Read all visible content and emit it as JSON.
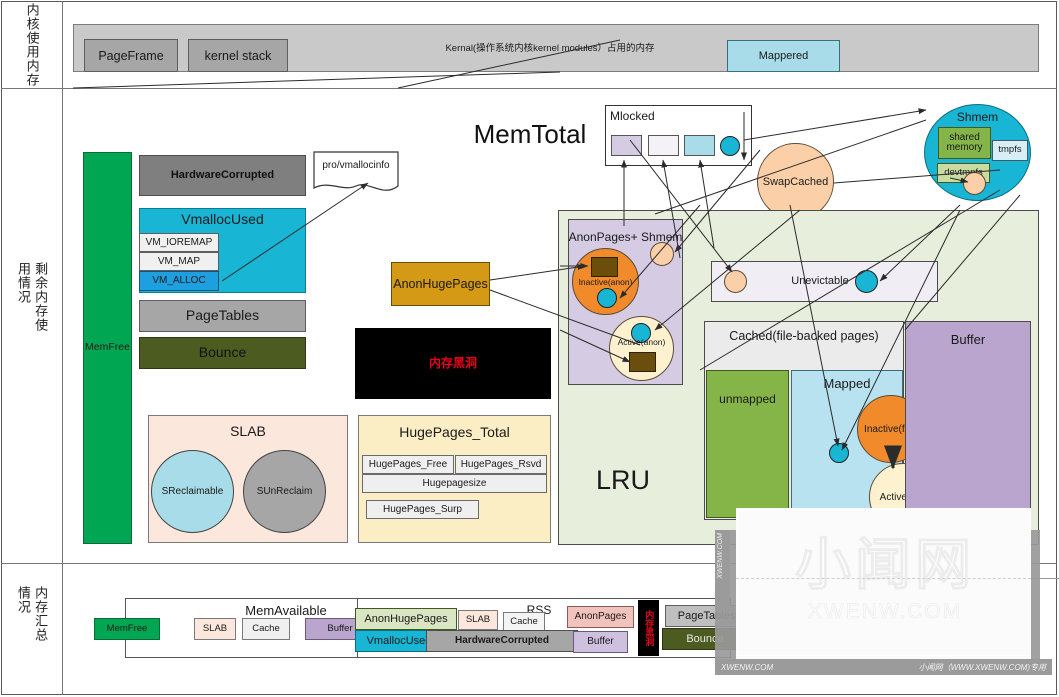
{
  "rows": {
    "kernel": "内核使用内存",
    "remaining": "剩余内存使用情况",
    "summary": "内存汇总情况"
  },
  "kernel_band": {
    "pageframe": "PageFrame",
    "kernel_stack": "kernel stack",
    "kernel_note": "Kernal(操作系统内核kernel modules）占用的内存",
    "mappered": "Mappered"
  },
  "middle": {
    "memtotal": "MemTotal",
    "memfree": "MemFree",
    "hardware_corrupted": "HardwareCorrupted",
    "vmalloc_used": "VmallocUsed",
    "vm_ioremap": "VM_IOREMAP",
    "vm_map": "VM_MAP",
    "vm_alloc": "VM_ALLOC",
    "pagetables": "PageTables",
    "bounce": "Bounce",
    "proc_vmallocinfo": "pro/vmallocinfo",
    "anonhugepages": "AnonHugePages",
    "blackhole": "内存黑洞",
    "slab": "SLAB",
    "sreclaimable": "SReclaimable",
    "sunreclaim": "SUnReclaim",
    "hugepages_total": "HugePages_Total",
    "hugepages_free": "HugePages_Free",
    "hugepages_rsvd": "HugePages_Rsvd",
    "hugepagesize": "Hugepagesize",
    "hugepages_surp": "HugePages_Surp",
    "mlocked": "Mlocked",
    "swapcached": "SwapCached",
    "shmem": "Shmem",
    "shared_memory": "shared memory",
    "tmpfs": "tmpfs",
    "devtmpfs": "devtmpfs",
    "lru": "LRU",
    "anonpages_shmem": "AnonPages+ Shmem",
    "inactive_anon": "Inactive(anon)",
    "active_anon": "Active(anon)",
    "unevictable": "Unevictable",
    "cached": "Cached(file-backed pages)",
    "unmapped": "unmapped",
    "mapped": "Mapped",
    "inactive_file": "Inactive(file)",
    "active_file": "Active(file)",
    "buffer": "Buffer"
  },
  "summary": {
    "memavailable": "MemAvailable",
    "memfree": "MemFree",
    "slab": "SLAB",
    "cache": "Cache",
    "buffer": "Buffer",
    "rss": "RSS",
    "anonhugepages": "AnonHugePages",
    "vmallocused": "VmallocUsed",
    "slab2": "SLAB",
    "cache2": "Cache",
    "hardware_corrupted": "HardwareCorrupted",
    "anonpages": "AnonPages",
    "buffer2": "Buffer",
    "blackhole": "内存黑洞",
    "pagetables": "PageTables",
    "bounce": "Bounce"
  },
  "watermark": {
    "logo": "小闻网",
    "domain": "XWENW.COM",
    "bar_left": "XWENW.COM",
    "bar_right": "小闻网（WWW.XWENW.COM)专用",
    "side": "XWENW.COM"
  },
  "colors": {
    "gray_band": "#c9c9c9",
    "gray_box": "#a6a6a6",
    "dark_gray": "#7f7f7f",
    "light_blue": "#add8e6",
    "cyan": "#18b5d4",
    "bright_blue": "#1e9fe0",
    "green": "#00a651",
    "olive": "#4c5c21",
    "orange": "#f08a2a",
    "gold": "#d49a16",
    "peach": "#fbd0a8",
    "cream": "#fdf1cf",
    "lavender": "#d5cce4",
    "purple": "#b9a5cd",
    "leaf_green": "#85b548",
    "pale_green": "#e8eedc",
    "pale_pink": "#fce7dc",
    "pale_yellow": "#fbeec4",
    "black": "#000000",
    "red": "#e8001c"
  }
}
